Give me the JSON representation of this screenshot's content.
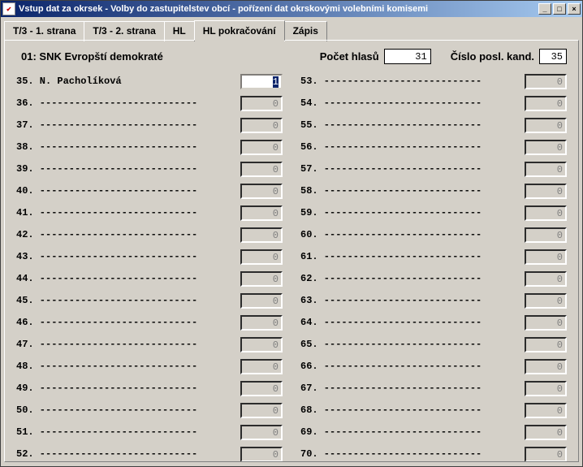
{
  "window": {
    "title": "Vstup dat za okrsek - Volby do zastupitelstev obcí - pořízení dat okrskovými volebními komisemi",
    "iconGlyph": "✔"
  },
  "tabs": [
    {
      "label": "T/3 - 1. strana",
      "active": false
    },
    {
      "label": "T/3 - 2. strana",
      "active": false
    },
    {
      "label": "HL",
      "active": false
    },
    {
      "label": "HL pokračování",
      "active": true
    },
    {
      "label": "Zápis",
      "active": false
    }
  ],
  "header": {
    "party": "01: SNK Evropští demokraté",
    "votesLabel": "Počet hlasů",
    "votesValue": "31",
    "lastCandLabel": "Číslo posl. kand.",
    "lastCandValue": "35"
  },
  "rowsLeft": [
    {
      "num": "35.",
      "name": "N. Pacholíková",
      "value": "1",
      "active": true
    },
    {
      "num": "36.",
      "name": "---------------------------",
      "value": "0",
      "active": false
    },
    {
      "num": "37.",
      "name": "---------------------------",
      "value": "0",
      "active": false
    },
    {
      "num": "38.",
      "name": "---------------------------",
      "value": "0",
      "active": false
    },
    {
      "num": "39.",
      "name": "---------------------------",
      "value": "0",
      "active": false
    },
    {
      "num": "40.",
      "name": "---------------------------",
      "value": "0",
      "active": false
    },
    {
      "num": "41.",
      "name": "---------------------------",
      "value": "0",
      "active": false
    },
    {
      "num": "42.",
      "name": "---------------------------",
      "value": "0",
      "active": false
    },
    {
      "num": "43.",
      "name": "---------------------------",
      "value": "0",
      "active": false
    },
    {
      "num": "44.",
      "name": "---------------------------",
      "value": "0",
      "active": false
    },
    {
      "num": "45.",
      "name": "---------------------------",
      "value": "0",
      "active": false
    },
    {
      "num": "46.",
      "name": "---------------------------",
      "value": "0",
      "active": false
    },
    {
      "num": "47.",
      "name": "---------------------------",
      "value": "0",
      "active": false
    },
    {
      "num": "48.",
      "name": "---------------------------",
      "value": "0",
      "active": false
    },
    {
      "num": "49.",
      "name": "---------------------------",
      "value": "0",
      "active": false
    },
    {
      "num": "50.",
      "name": "---------------------------",
      "value": "0",
      "active": false
    },
    {
      "num": "51.",
      "name": "---------------------------",
      "value": "0",
      "active": false
    },
    {
      "num": "52.",
      "name": "---------------------------",
      "value": "0",
      "active": false
    }
  ],
  "rowsRight": [
    {
      "num": "53.",
      "name": "---------------------------",
      "value": "0",
      "active": false
    },
    {
      "num": "54.",
      "name": "---------------------------",
      "value": "0",
      "active": false
    },
    {
      "num": "55.",
      "name": "---------------------------",
      "value": "0",
      "active": false
    },
    {
      "num": "56.",
      "name": "---------------------------",
      "value": "0",
      "active": false
    },
    {
      "num": "57.",
      "name": "---------------------------",
      "value": "0",
      "active": false
    },
    {
      "num": "58.",
      "name": "---------------------------",
      "value": "0",
      "active": false
    },
    {
      "num": "59.",
      "name": "---------------------------",
      "value": "0",
      "active": false
    },
    {
      "num": "60.",
      "name": "---------------------------",
      "value": "0",
      "active": false
    },
    {
      "num": "61.",
      "name": "---------------------------",
      "value": "0",
      "active": false
    },
    {
      "num": "62.",
      "name": "---------------------------",
      "value": "0",
      "active": false
    },
    {
      "num": "63.",
      "name": "---------------------------",
      "value": "0",
      "active": false
    },
    {
      "num": "64.",
      "name": "---------------------------",
      "value": "0",
      "active": false
    },
    {
      "num": "65.",
      "name": "---------------------------",
      "value": "0",
      "active": false
    },
    {
      "num": "66.",
      "name": "---------------------------",
      "value": "0",
      "active": false
    },
    {
      "num": "67.",
      "name": "---------------------------",
      "value": "0",
      "active": false
    },
    {
      "num": "68.",
      "name": "---------------------------",
      "value": "0",
      "active": false
    },
    {
      "num": "69.",
      "name": "---------------------------",
      "value": "0",
      "active": false
    },
    {
      "num": "70.",
      "name": "---------------------------",
      "value": "0",
      "active": false
    }
  ]
}
